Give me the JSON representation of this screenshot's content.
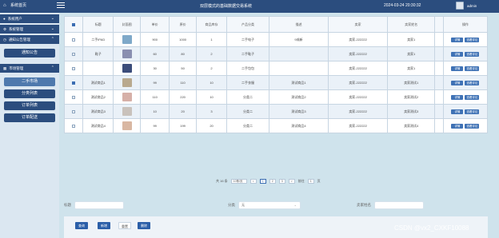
{
  "header": {
    "brand": "系统首页",
    "title": "双层模式的基础数据交易系统",
    "datetime": "2024-03-24 20:30:32",
    "username": "admin"
  },
  "sidebar": {
    "groups": [
      {
        "label": "系统用户"
      },
      {
        "label": "系统管理"
      },
      {
        "label": "通知公告管理"
      }
    ],
    "notice_button": "通知公告",
    "market_group": "市场管理",
    "buttons": [
      {
        "label": "二手市场",
        "active": true
      },
      {
        "label": "分类列表",
        "active": false
      },
      {
        "label": "订单列表",
        "active": false
      },
      {
        "label": "订单配送",
        "active": false
      }
    ]
  },
  "table": {
    "headers": [
      "",
      "标题",
      "封面图",
      "单价",
      "原价",
      "商品库存",
      "产品分类",
      "描述",
      "卖家",
      "卖家姓名",
      "",
      "操作"
    ],
    "rows": [
      {
        "checked": false,
        "title": "二手iPAD",
        "thumb_color": "#7fa9c9",
        "price": "900",
        "orig": "1000",
        "stock": "1",
        "category": "二手电子",
        "desc": "9成新",
        "seller": "卖家-222222",
        "seller_name": "卖家1",
        "actions": [
          "详情",
          "查看评论"
        ]
      },
      {
        "checked": false,
        "title": "鞋子",
        "thumb_color": "#8a8fb0",
        "price": "60",
        "orig": "80",
        "stock": "2",
        "category": "二手鞋子",
        "desc": "",
        "seller": "卖家-222222",
        "seller_name": "卖家1",
        "actions": [
          "详情",
          "查看评论"
        ]
      },
      {
        "checked": false,
        "title": "",
        "thumb_color": "#3c4d7a",
        "price": "30",
        "orig": "50",
        "stock": "2",
        "category": "二手包包",
        "desc": "",
        "seller": "卖家-222222",
        "seller_name": "卖家1",
        "actions": [
          "详情",
          "查看评论"
        ]
      },
      {
        "checked": true,
        "title": "测试商品1",
        "thumb_color": "#b9a98e",
        "price": "99",
        "orig": "110",
        "stock": "10",
        "category": "二手衣服",
        "desc": "测试商品1",
        "seller": "卖家-222222",
        "seller_name": "卖家测试1",
        "actions": [
          "详情",
          "查看评论"
        ]
      },
      {
        "checked": false,
        "title": "测试商品2",
        "thumb_color": "#d6b0a8",
        "price": "110",
        "orig": "220",
        "stock": "10",
        "category": "分类二",
        "desc": "测试商品2",
        "seller": "卖家-222222",
        "seller_name": "卖家测试2",
        "actions": [
          "详情",
          "查看评论"
        ]
      },
      {
        "checked": false,
        "title": "测试商品3",
        "thumb_color": "#c9c2bc",
        "price": "10",
        "orig": "20",
        "stock": "3",
        "category": "分类二",
        "desc": "测试商品3",
        "seller": "卖家-222222",
        "seller_name": "卖家测试3",
        "actions": [
          "详情",
          "查看评论"
        ]
      },
      {
        "checked": false,
        "title": "测试商品4",
        "thumb_color": "#d9b7a2",
        "price": "99",
        "orig": "199",
        "stock": "20",
        "category": "分类二",
        "desc": "测试商品4",
        "seller": "卖家-222222",
        "seller_name": "卖家测试4",
        "actions": [
          "详情",
          "查看评论"
        ]
      }
    ]
  },
  "pager": {
    "total": "共 16 条",
    "per_page": "10条/页",
    "prev": "<",
    "pages": [
      "1",
      "2",
      "3"
    ],
    "current": "1",
    "next": ">",
    "goto_label": "前往",
    "goto_value": "1",
    "goto_suffix": "页"
  },
  "search": {
    "title_label": "标题",
    "category_label": "分类",
    "category_value": "无",
    "seller_label": "卖家姓名"
  },
  "actions": {
    "query": "查询",
    "add": "新增",
    "reset": "重置",
    "delete": "删除"
  },
  "watermark": "CSDN @vx2_CXKF10088"
}
